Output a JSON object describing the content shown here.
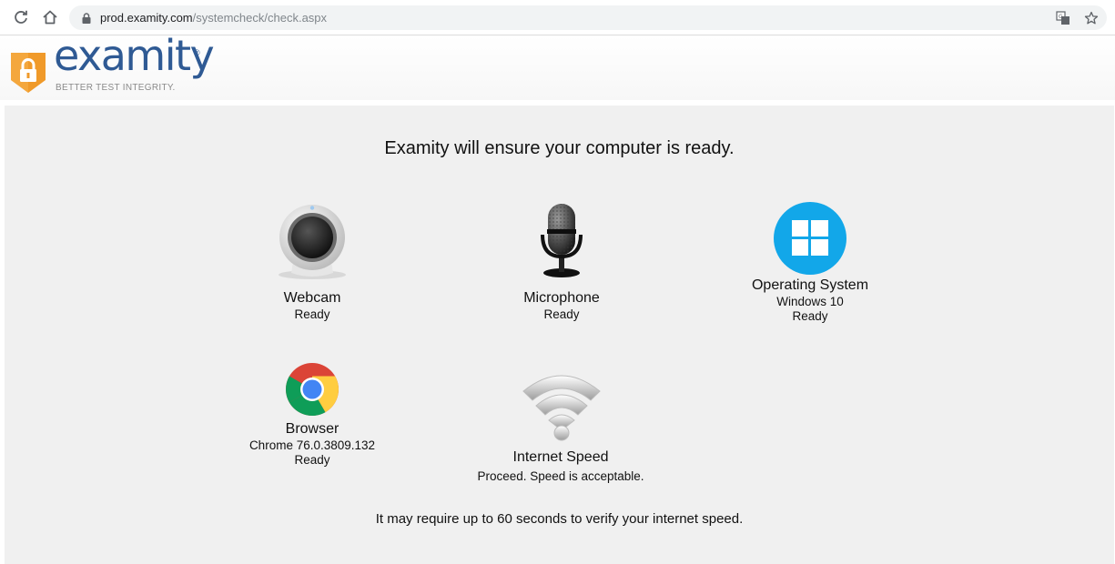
{
  "browser": {
    "url_domain": "prod.examity.com",
    "url_path": "/systemcheck/check.aspx"
  },
  "logo": {
    "brand": "examity",
    "registered": "®",
    "tagline": "BETTER TEST INTEGRITY."
  },
  "headline": "Examity will ensure your computer is ready.",
  "checks": {
    "webcam": {
      "title": "Webcam",
      "status": "Ready"
    },
    "microphone": {
      "title": "Microphone",
      "status": "Ready"
    },
    "os": {
      "title": "Operating System",
      "detail": "Windows 10",
      "status": "Ready"
    },
    "browser": {
      "title": "Browser",
      "detail": "Chrome 76.0.3809.132",
      "status": "Ready"
    },
    "internet": {
      "title": "Internet Speed",
      "status": "Proceed. Speed is acceptable."
    }
  },
  "footnote": "It may require up to 60 seconds to verify your internet speed.",
  "colors": {
    "brand_blue": "#2f5a94",
    "shield_orange": "#f09a2a",
    "windows_blue": "#12a7e9",
    "panel_bg": "#f0f0f0"
  }
}
